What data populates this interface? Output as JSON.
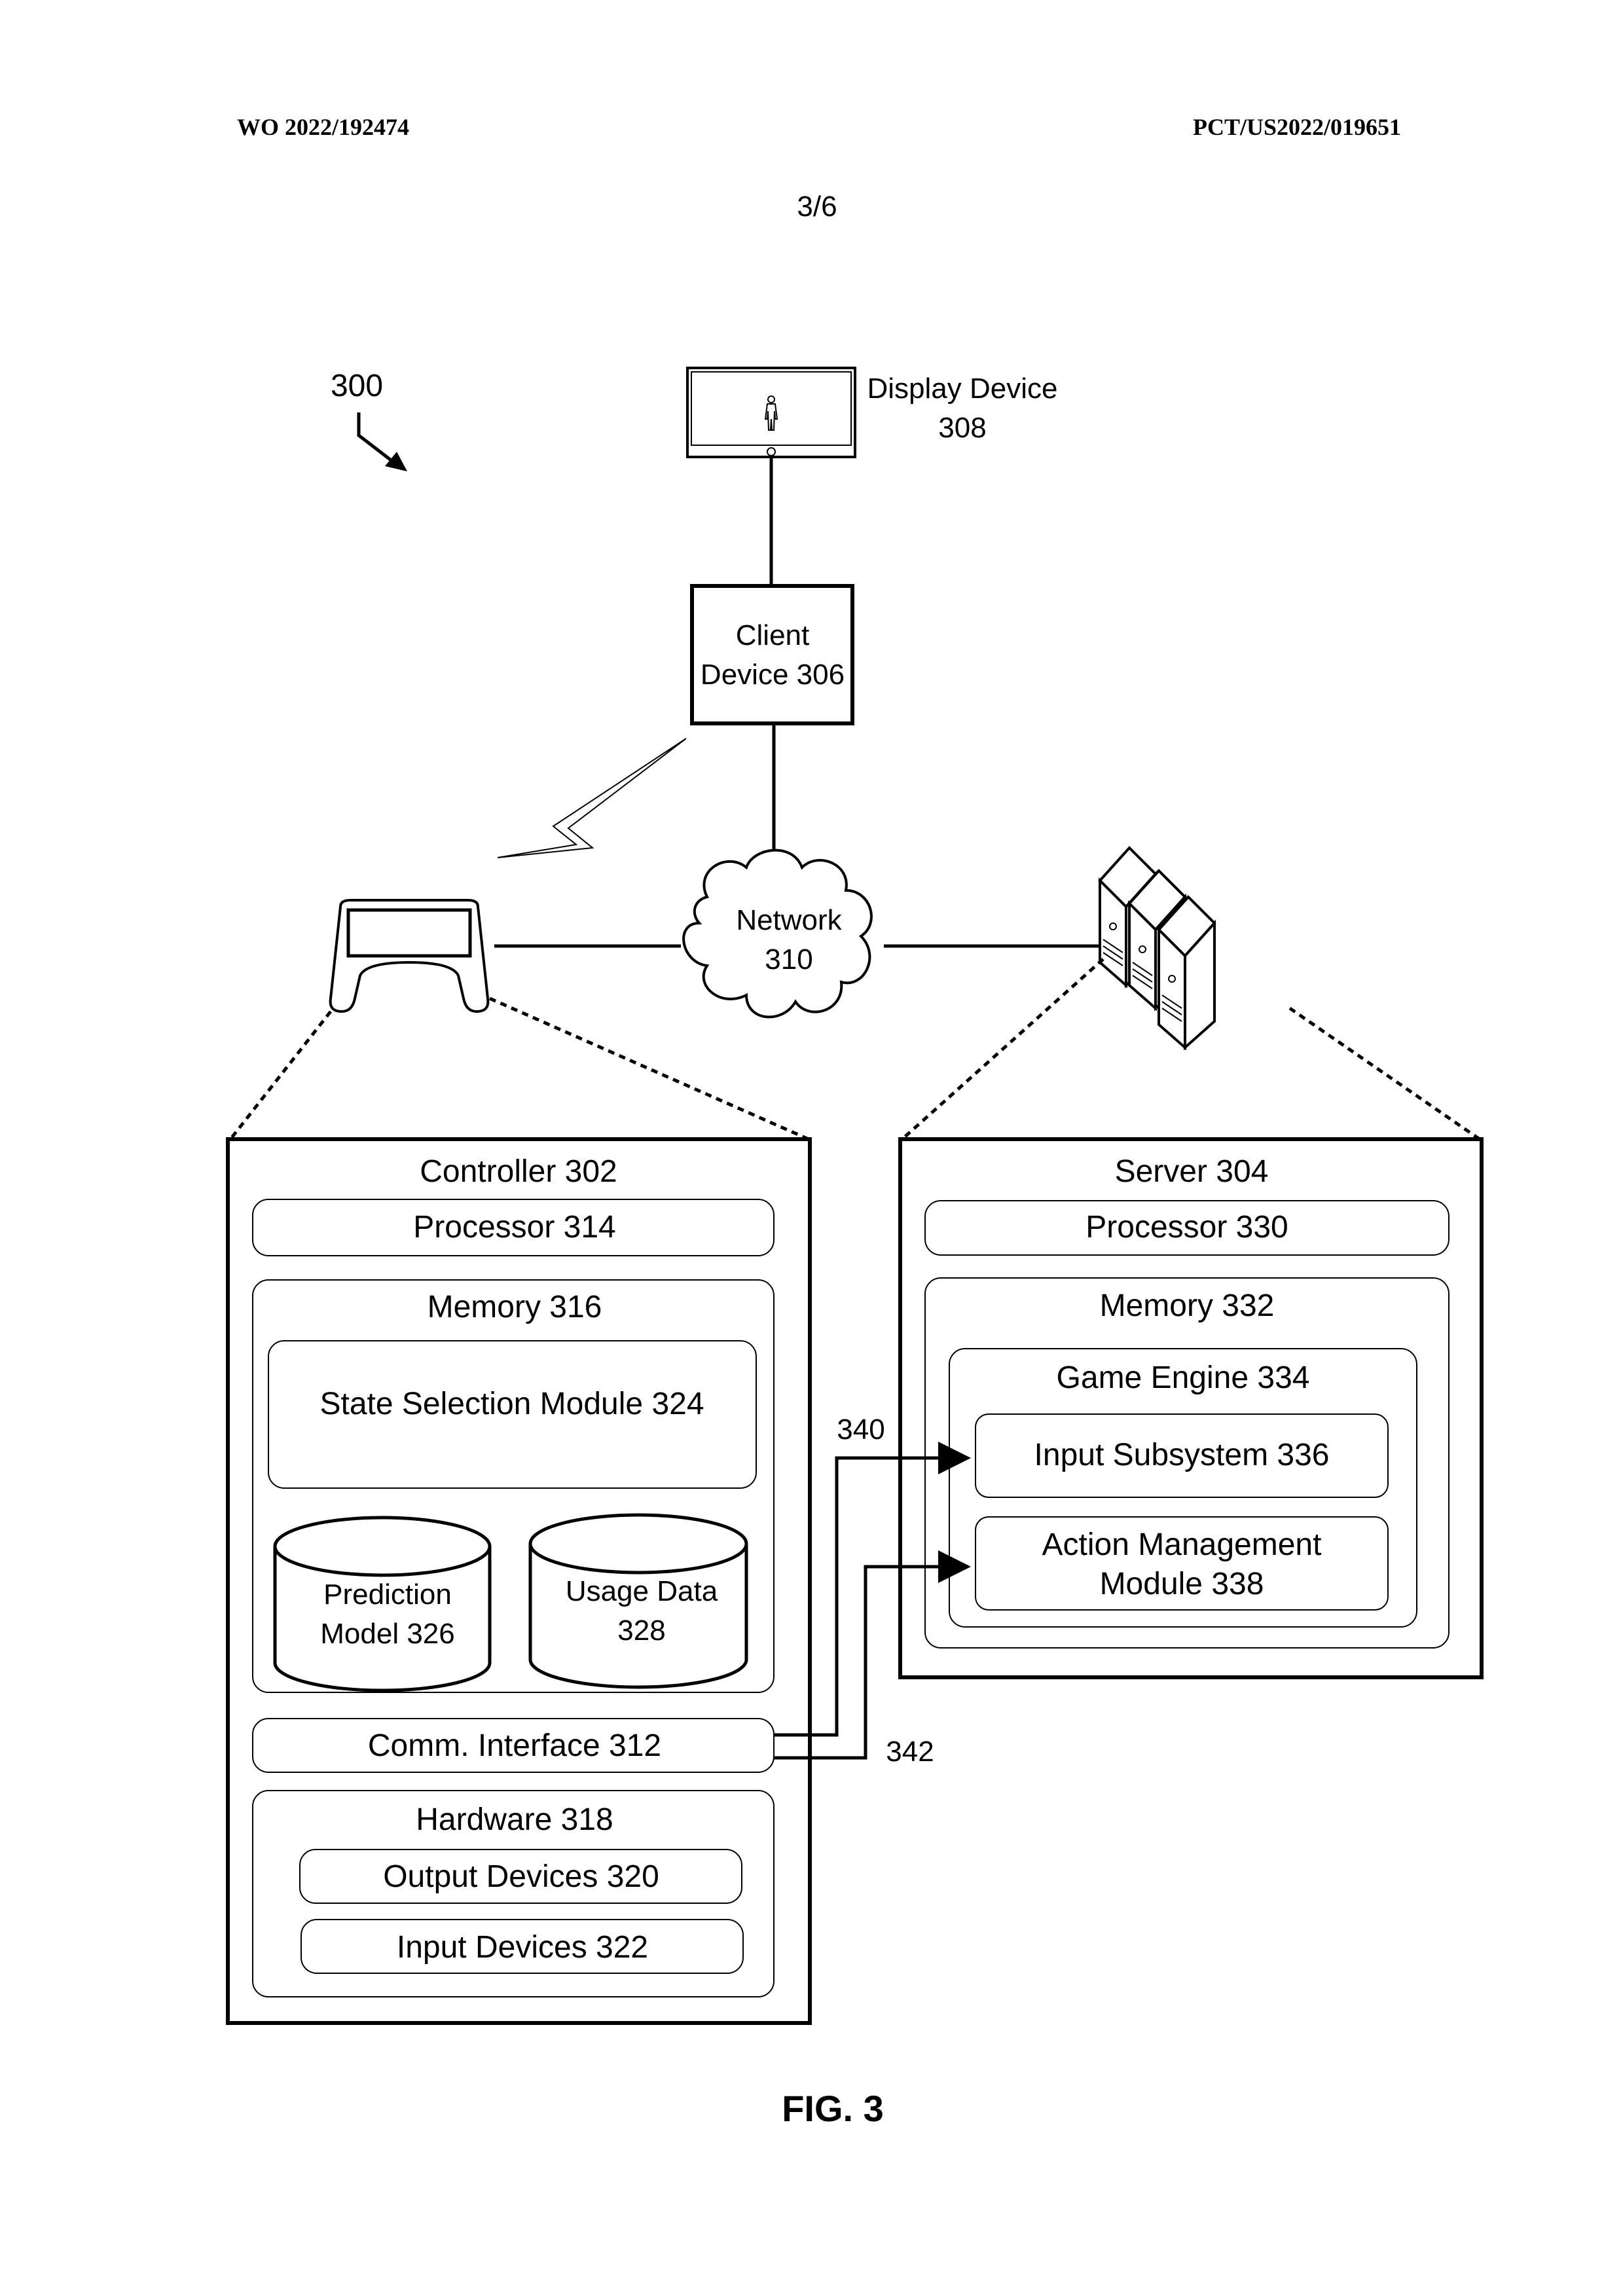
{
  "header": {
    "publication_number": "WO 2022/192474",
    "application_number": "PCT/US2022/019651",
    "sheet": "3/6"
  },
  "figure": {
    "reference": "300",
    "caption": "FIG. 3"
  },
  "nodes": {
    "display_device": {
      "line1": "Display Device",
      "line2": "308",
      "icon": "monitor-with-person-icon"
    },
    "client_device": {
      "line1": "Client",
      "line2": "Device 306"
    },
    "network": {
      "line1": "Network",
      "line2": "310",
      "icon": "cloud-icon"
    },
    "controller_icon": {
      "icon": "game-controller-icon"
    },
    "server_icon": {
      "icon": "server-stack-icon"
    },
    "wireless": {
      "icon": "lightning-bolt-wireless-icon"
    }
  },
  "controller": {
    "title": "Controller 302",
    "processor": "Processor 314",
    "memory": {
      "title": "Memory 316",
      "state_selection_module": "State Selection Module 324",
      "prediction_model": {
        "line1": "Prediction",
        "line2": "Model 326"
      },
      "usage_data": {
        "line1": "Usage Data",
        "line2": "328"
      }
    },
    "comm_interface": "Comm. Interface 312",
    "hardware": {
      "title": "Hardware 318",
      "output_devices": "Output Devices 320",
      "input_devices": "Input Devices 322"
    }
  },
  "server": {
    "title": "Server 304",
    "processor": "Processor 330",
    "memory": {
      "title": "Memory 332",
      "game_engine": {
        "title": "Game Engine 334",
        "input_subsystem": "Input Subsystem 336",
        "action_management": {
          "line1": "Action Management",
          "line2": "Module 338"
        }
      }
    }
  },
  "connections": {
    "upper": "340",
    "lower": "342"
  }
}
